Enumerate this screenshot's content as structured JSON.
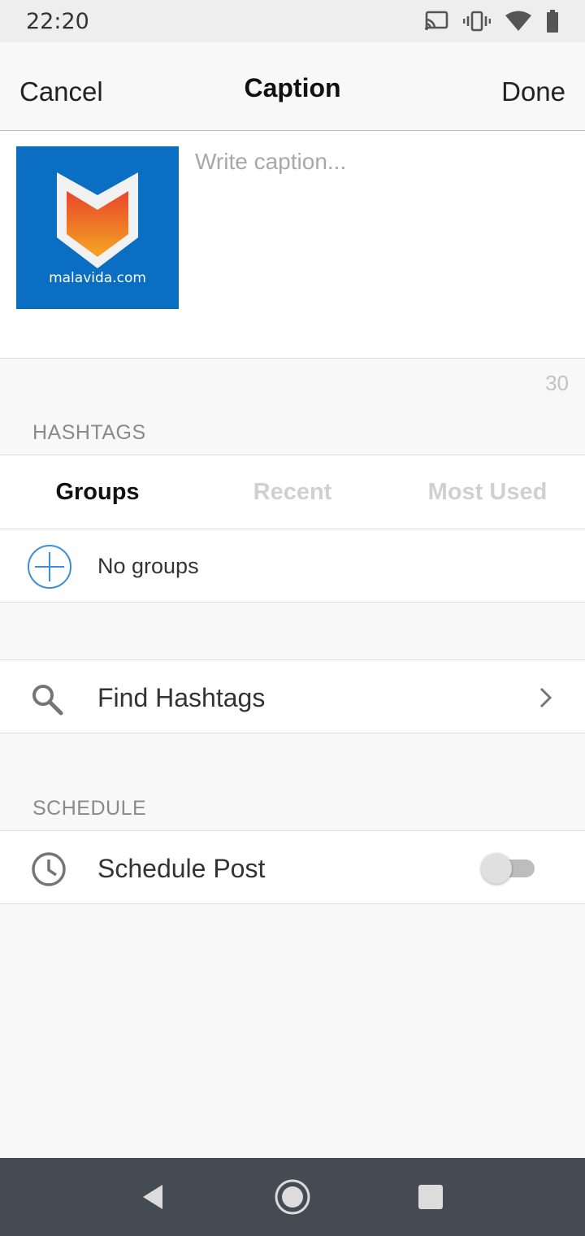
{
  "status_bar": {
    "time": "22:20",
    "icons": [
      "cast-icon",
      "vibrate-icon",
      "wifi-icon",
      "battery-icon"
    ]
  },
  "navbar": {
    "cancel_label": "Cancel",
    "title": "Caption",
    "done_label": "Done"
  },
  "caption": {
    "thumbnail_text": "malavida.com",
    "placeholder": "Write caption...",
    "value": "",
    "remaining_count": "30"
  },
  "hashtags": {
    "section_title": "HASHTAGS",
    "tabs": [
      {
        "label": "Groups",
        "active": true
      },
      {
        "label": "Recent",
        "active": false
      },
      {
        "label": "Most Used",
        "active": false
      }
    ],
    "empty_label": "No groups",
    "find_label": "Find Hashtags"
  },
  "schedule": {
    "section_title": "SCHEDULE",
    "schedule_label": "Schedule Post",
    "enabled": false
  },
  "colors": {
    "accent": "#3a8fd6",
    "thumb_bg": "#0a6fc2",
    "nav_bar": "#454b53"
  }
}
